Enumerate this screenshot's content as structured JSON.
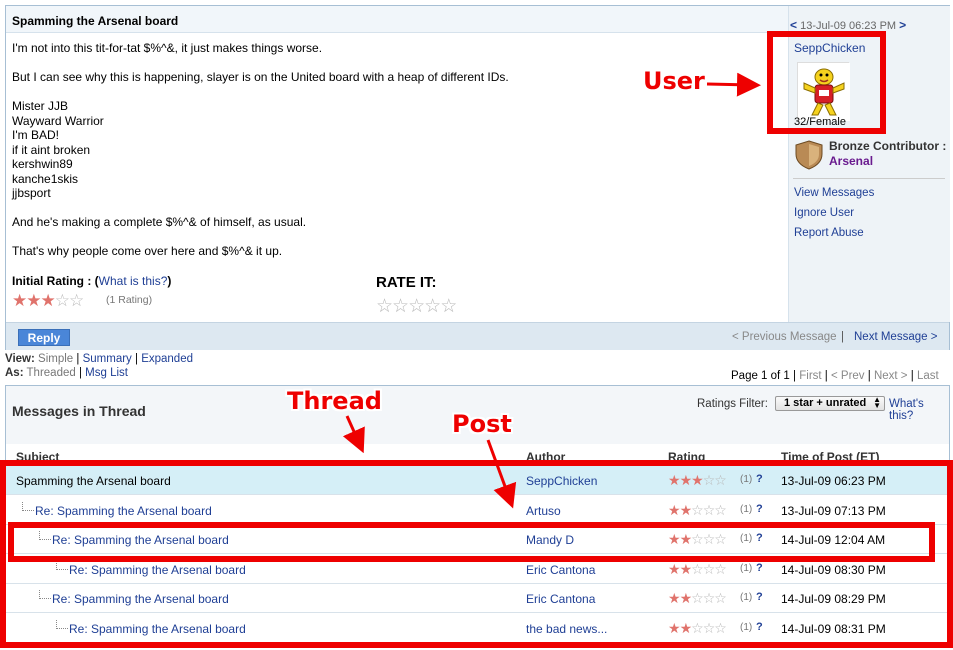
{
  "post": {
    "title": "Spamming the Arsenal board",
    "paragraphs": [
      "I'm not into this tit-for-tat $%^&, it just makes things worse.",
      "But I can see why this is happening, slayer is on the United board with a heap of different IDs."
    ],
    "names": [
      "Mister JJB",
      "Wayward Warrior",
      "I'm BAD!",
      "if it aint broken",
      "kershwin89",
      "kanche1skis",
      "jjbsport"
    ],
    "closing": [
      "And he's making a complete $%^& of himself, as usual.",
      "That's why people come over here and $%^& it up."
    ],
    "initial_rating_label": "Initial Rating : (",
    "what_is_this": "What is this?",
    "close_paren": ")",
    "rating_stars": 3,
    "rating_count": "(1 Rating)",
    "rate_it": "RATE IT:"
  },
  "sidebar": {
    "time_prefix": "<",
    "time": "13-Jul-09 06:23 PM",
    "time_suffix": ">",
    "user_name": "SeppChicken",
    "user_stats": "32/Female",
    "badge_title": "Bronze Contributor :",
    "badge_team": "Arsenal",
    "links": [
      "View Messages",
      "Ignore User",
      "Report Abuse"
    ]
  },
  "reply_bar": {
    "reply": "Reply",
    "prev": "< Previous Message",
    "sep": "|",
    "next": "Next Message >"
  },
  "view": {
    "view_label": "View:",
    "simple": "Simple",
    "summary": "Summary",
    "expanded": "Expanded",
    "as_label": "As:",
    "threaded": "Threaded",
    "msg_list": "Msg List",
    "sep": "|"
  },
  "pager": {
    "page": "Page 1 of 1",
    "first": "First",
    "prev": "< Prev",
    "next": "Next >",
    "last": "Last",
    "sep": "|"
  },
  "thread": {
    "title": "Messages in Thread",
    "filter_label": "Ratings Filter:",
    "filter_value": "1 star + unrated",
    "filter_help": "What's this?",
    "columns": [
      "Subject",
      "Author",
      "Rating",
      "Time of Post (ET)"
    ],
    "rows": [
      {
        "subject": "Spamming the Arsenal board",
        "author": "SeppChicken",
        "stars": 3,
        "count": "(1)",
        "help": "?",
        "time": "13-Jul-09 06:23 PM",
        "depth": 0
      },
      {
        "subject": "Re: Spamming the Arsenal board",
        "author": "Artuso",
        "stars": 2,
        "count": "(1)",
        "help": "?",
        "time": "13-Jul-09 07:13 PM",
        "depth": 1
      },
      {
        "subject": "Re: Spamming the Arsenal board",
        "author": "Mandy D",
        "stars": 2,
        "count": "(1)",
        "help": "?",
        "time": "14-Jul-09 12:04 AM",
        "depth": 2
      },
      {
        "subject": "Re: Spamming the Arsenal board",
        "author": "Eric Cantona",
        "stars": 2,
        "count": "(1)",
        "help": "?",
        "time": "14-Jul-09 08:30 PM",
        "depth": 3
      },
      {
        "subject": "Re: Spamming the Arsenal board",
        "author": "Eric Cantona",
        "stars": 2,
        "count": "(1)",
        "help": "?",
        "time": "14-Jul-09 08:29 PM",
        "depth": 2
      },
      {
        "subject": "Re: Spamming the Arsenal board",
        "author": "the bad news...",
        "stars": 2,
        "count": "(1)",
        "help": "?",
        "time": "14-Jul-09 08:31 PM",
        "depth": 3
      }
    ]
  },
  "annotations": {
    "user": "User",
    "thread": "Thread",
    "post": "Post"
  },
  "colors": {
    "annotation_red": "#ee0000",
    "link_blue": "#1f3f95",
    "selected_row": "#d5eff7",
    "star_filled": "#e0736c",
    "badge_team_purple": "#6a1b8f"
  },
  "icons": [
    "bronze-shield-icon",
    "avatar-chicken-icon",
    "dropdown-arrow-icon"
  ]
}
